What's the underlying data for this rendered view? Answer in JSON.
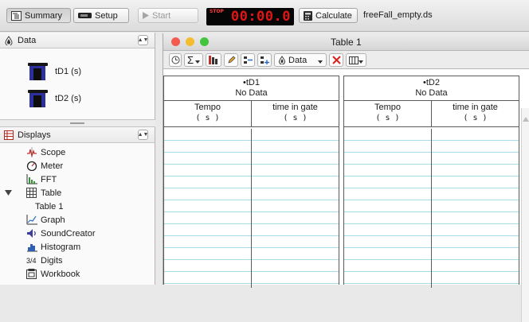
{
  "toolbar": {
    "summary_label": "Summary",
    "setup_label": "Setup",
    "start_label": "Start",
    "timer_badge": "STOP",
    "timer_value": "00:00.0",
    "calculate_label": "Calculate",
    "filename": "freeFall_empty.ds"
  },
  "data_panel": {
    "title": "Data",
    "sets": [
      {
        "label": "tD1 (s)"
      },
      {
        "label": "tD2 (s)"
      }
    ]
  },
  "displays_panel": {
    "title": "Displays",
    "items": [
      {
        "label": "Scope",
        "icon": "scope-icon"
      },
      {
        "label": "Meter",
        "icon": "meter-icon"
      },
      {
        "label": "FFT",
        "icon": "fft-icon"
      },
      {
        "label": "Table",
        "icon": "table-icon",
        "expanded": true
      },
      {
        "label": "Table 1",
        "sub": true
      },
      {
        "label": "Graph",
        "icon": "graph-icon"
      },
      {
        "label": "SoundCreator",
        "icon": "speaker-icon"
      },
      {
        "label": "Histogram",
        "icon": "histogram-icon"
      },
      {
        "label": "Digits",
        "icon": "digits-icon",
        "icon_text": "3/4"
      },
      {
        "label": "Workbook",
        "icon": "workbook-icon"
      }
    ]
  },
  "table_window": {
    "title": "Table 1",
    "data_menu_label": "Data",
    "tables": [
      {
        "name": "•tD1",
        "status": "No Data",
        "columns": [
          {
            "label": "Tempo",
            "unit": "( s )"
          },
          {
            "label": "time in gate",
            "unit": "( s )"
          }
        ]
      },
      {
        "name": "•tD2",
        "status": "No Data",
        "columns": [
          {
            "label": "Tempo",
            "unit": "( s )"
          },
          {
            "label": "time in gate",
            "unit": "( s )"
          }
        ]
      }
    ]
  },
  "colors": {
    "timer_red": "#e01616",
    "row_line": "#a8dbe8",
    "close_light": "#f35b51",
    "minimize_light": "#f4bc2f",
    "zoom_light": "#42c43c",
    "sensor_blue": "#2c2f9c"
  }
}
